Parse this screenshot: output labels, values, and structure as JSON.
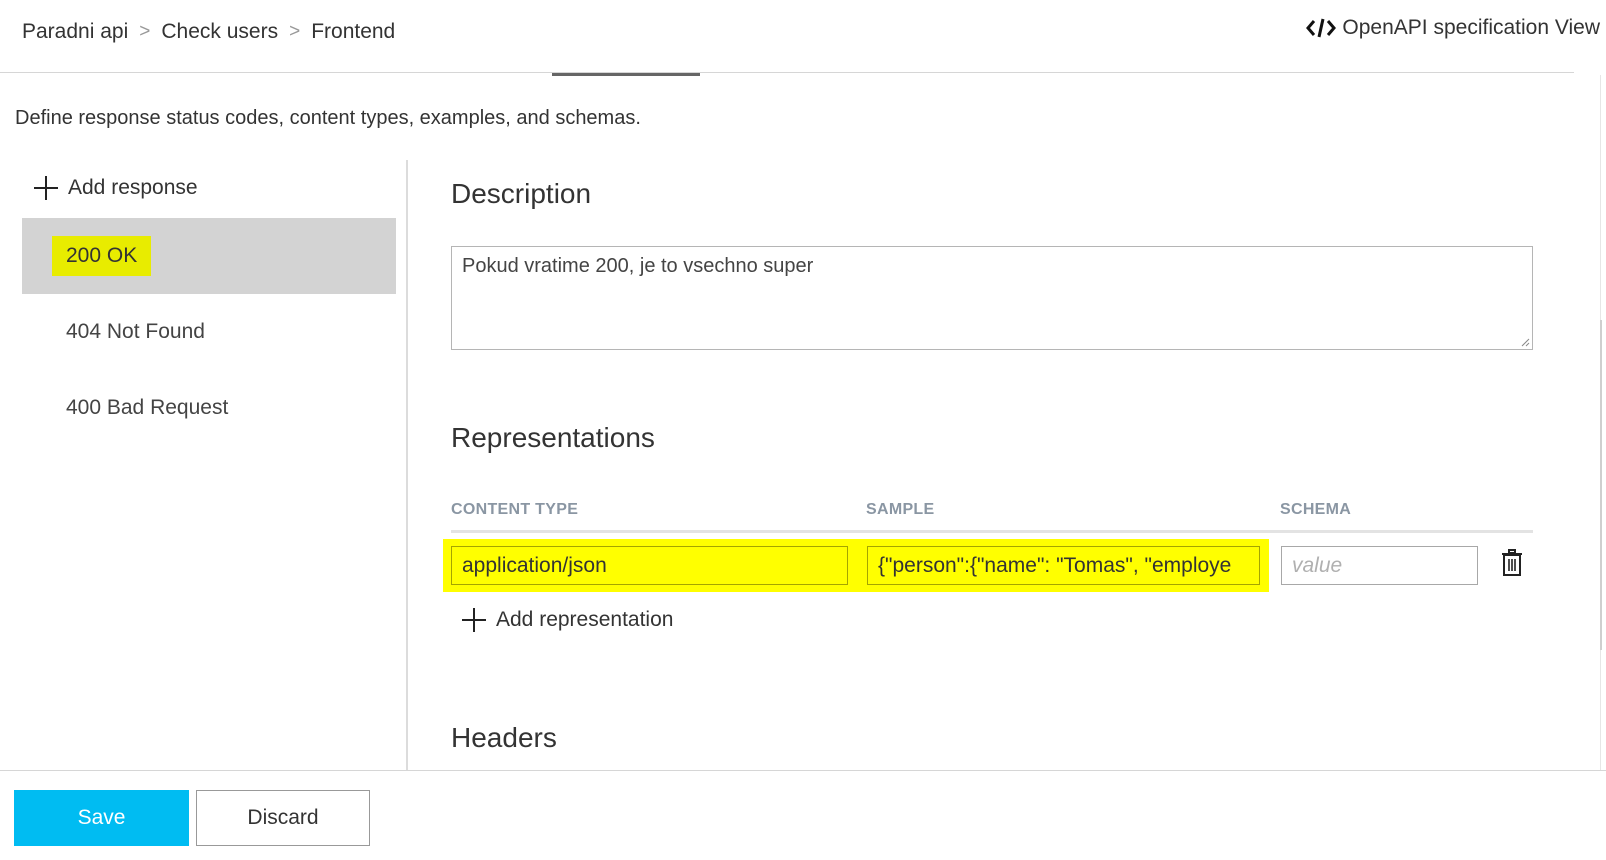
{
  "breadcrumb": {
    "items": [
      "Paradni api",
      "Check users",
      "Frontend"
    ],
    "separator": ">"
  },
  "spec_link": {
    "label": "OpenAPI specification View",
    "icon": "code-icon"
  },
  "intro": "Define response status codes, content types, examples, and schemas.",
  "responses": {
    "add_label": "Add response",
    "items": [
      {
        "label": "200 OK",
        "selected": true
      },
      {
        "label": "404 Not Found",
        "selected": false
      },
      {
        "label": "400 Bad Request",
        "selected": false
      }
    ]
  },
  "description": {
    "title": "Description",
    "value": "Pokud vratime 200, je to vsechno super"
  },
  "representations": {
    "title": "Representations",
    "columns": [
      "CONTENT TYPE",
      "SAMPLE",
      "SCHEMA"
    ],
    "rows": [
      {
        "content_type": "application/json",
        "sample": "{\"person\":{\"name\": \"Tomas\", \"employe",
        "schema_placeholder": "value"
      }
    ],
    "add_label": "Add representation"
  },
  "headers": {
    "title": "Headers"
  },
  "actions": {
    "save": "Save",
    "discard": "Discard"
  },
  "colors": {
    "highlight": "#ffff00",
    "primary": "#00bcf2",
    "selected_bg": "#d3d3d3"
  }
}
